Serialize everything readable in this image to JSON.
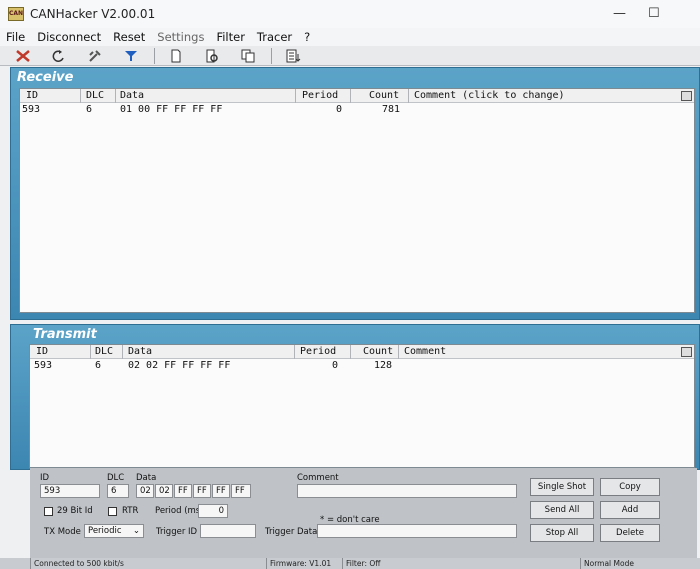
{
  "window": {
    "title": "CANHacker V2.00.01",
    "icon_text": "CAN",
    "minimize": "—",
    "maximize": "☐"
  },
  "menu": [
    "File",
    "Disconnect",
    "Reset",
    "Settings",
    "Filter",
    "Tracer",
    "?"
  ],
  "toolbar_icons": [
    "connect-icon",
    "reset-icon",
    "settings-icon",
    "filter-icon",
    "new-icon",
    "preview-icon",
    "copy-icon",
    "log-icon"
  ],
  "receive": {
    "title": "Receive",
    "columns": [
      "ID",
      "DLC",
      "Data",
      "Period",
      "Count",
      "Comment (click to change)"
    ],
    "rows": [
      {
        "id": "593",
        "dlc": "6",
        "data": "01 00 FF FF FF FF",
        "period": "0",
        "count": "781",
        "comment": ""
      }
    ]
  },
  "transmit": {
    "title": "Transmit",
    "columns": [
      "ID",
      "DLC",
      "Data",
      "Period",
      "Count",
      "Comment"
    ],
    "rows": [
      {
        "id": "593",
        "dlc": "6",
        "data": "02 02 FF FF FF FF",
        "period": "0",
        "count": "128",
        "comment": ""
      }
    ]
  },
  "form": {
    "id_label": "ID",
    "id_value": "593",
    "dlc_label": "DLC",
    "dlc_value": "6",
    "data_label": "Data",
    "data_bytes": [
      "02",
      "02",
      "FF",
      "FF",
      "FF",
      "FF"
    ],
    "comment_label": "Comment",
    "comment_value": "",
    "bit29_label": "29 Bit Id",
    "bit29_checked": false,
    "rtr_label": "RTR",
    "rtr_checked": false,
    "period_label": "Period (ms)",
    "period_value": "0",
    "dont_care": "* = don't care",
    "txmode_label": "TX Mode",
    "txmode_value": "Periodic",
    "trigger_id_label": "Trigger ID",
    "trigger_id_value": "",
    "trigger_data_label": "Trigger Data",
    "trigger_data_value": "",
    "buttons": {
      "single_shot": "Single Shot",
      "copy": "Copy",
      "send_all": "Send All",
      "add": "Add",
      "stop_all": "Stop All",
      "delete": "Delete"
    }
  },
  "status": {
    "connection": "Connected to 500 kbit/s",
    "firmware": "Firmware: V1.01",
    "filter": "Filter: Off",
    "mode": "Normal Mode"
  }
}
